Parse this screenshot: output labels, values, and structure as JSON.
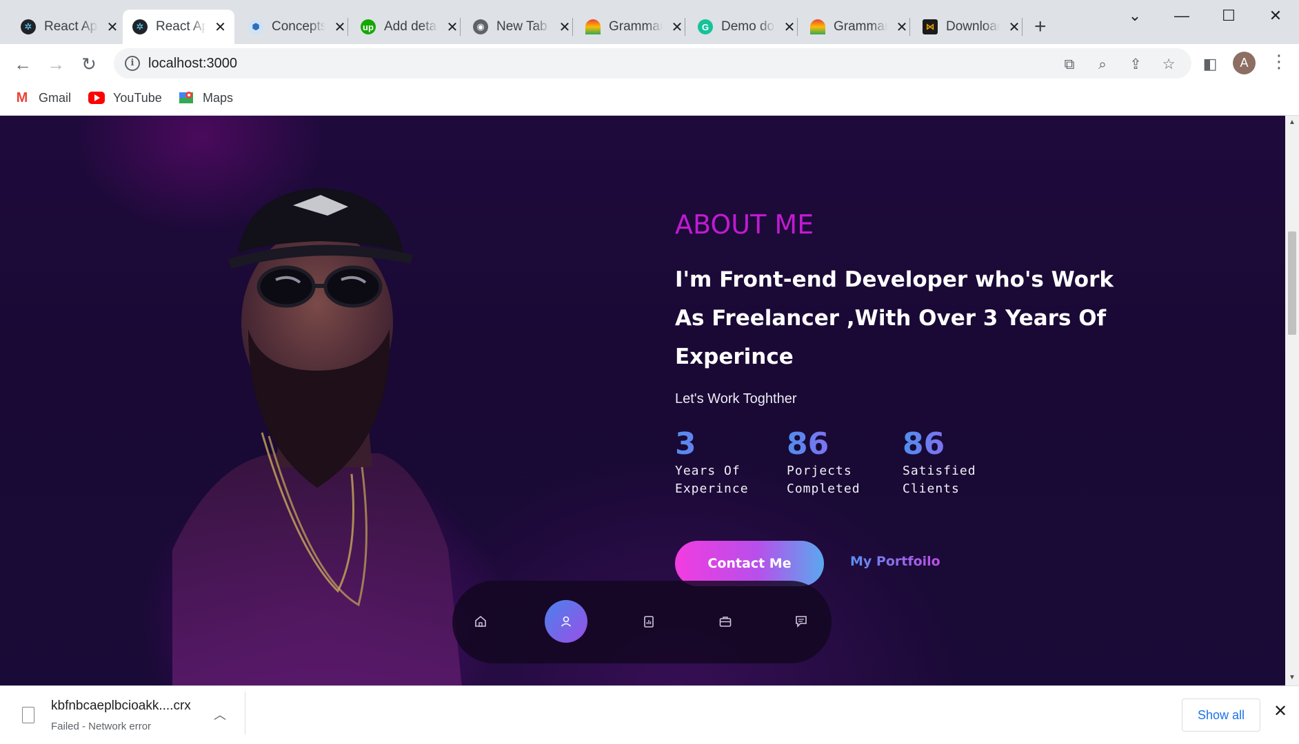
{
  "browser": {
    "tabs": [
      {
        "title": "React App",
        "icon": "react-icon",
        "color": "#61dafb",
        "active": false
      },
      {
        "title": "React App",
        "icon": "react-icon",
        "color": "#61dafb",
        "active": true
      },
      {
        "title": "Concepts",
        "icon": "cube-icon",
        "color": "#4a90d9",
        "active": false
      },
      {
        "title": "Add details",
        "icon": "upwork-icon",
        "color": "#14a800",
        "active": false
      },
      {
        "title": "New Tab",
        "icon": "chrome-icon",
        "color": "#5f6368",
        "active": false
      },
      {
        "title": "Grammarly",
        "icon": "rainbow-icon",
        "color": "#e94235",
        "active": false
      },
      {
        "title": "Demo doc",
        "icon": "grammarly-icon",
        "color": "#15c39a",
        "active": false
      },
      {
        "title": "Grammarly",
        "icon": "rainbow-icon",
        "color": "#e94235",
        "active": false
      },
      {
        "title": "Download",
        "icon": "download-site-icon",
        "color": "#f0a500",
        "active": false
      }
    ],
    "url": "localhost:3000",
    "profile_initial": "A",
    "bookmarks": [
      {
        "label": "Gmail",
        "icon": "gmail-icon"
      },
      {
        "label": "YouTube",
        "icon": "youtube-icon"
      },
      {
        "label": "Maps",
        "icon": "maps-icon"
      }
    ]
  },
  "page": {
    "section_label": "ABOUT ME",
    "headline": "I'm Front-end Developer who's Work As Freelancer ,With Over 3 Years Of Experince",
    "tagline": "Let's Work Toghther",
    "stats": [
      {
        "value": "3",
        "label_line1": "Years Of",
        "label_line2": "Experince"
      },
      {
        "value": "86",
        "label_line1": "Porjects",
        "label_line2": "Completed"
      },
      {
        "value": "86",
        "label_line1": "Satisfied",
        "label_line2": "Clients"
      }
    ],
    "contact_button": "Contact Me",
    "portfolio_link": "My Portfoilo",
    "nav": [
      {
        "name": "home-icon",
        "active": false
      },
      {
        "name": "user-icon",
        "active": true
      },
      {
        "name": "skills-icon",
        "active": false
      },
      {
        "name": "briefcase-icon",
        "active": false
      },
      {
        "name": "message-icon",
        "active": false
      }
    ],
    "colors": {
      "accent": "#c01bd0",
      "background": "#1a0a37",
      "stat_gradient_start": "#4f8fee",
      "stat_gradient_end": "#a25bf2"
    }
  },
  "downloads": {
    "file_name": "kbfnbcaeplbcioakk....crx",
    "status": "Failed - Network error",
    "show_all": "Show all"
  }
}
